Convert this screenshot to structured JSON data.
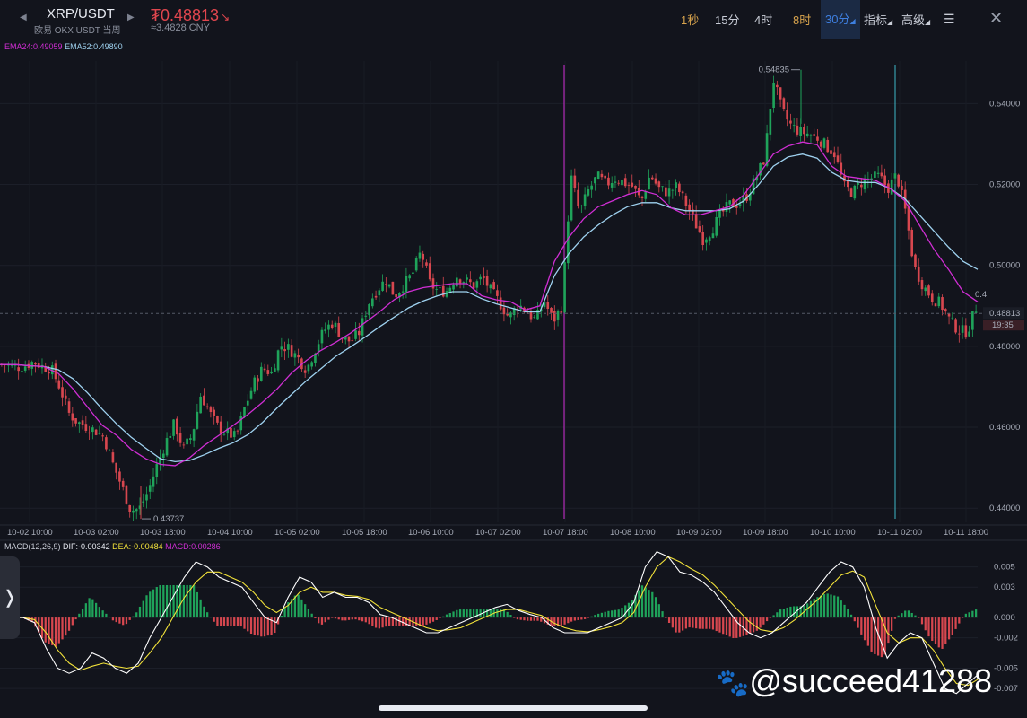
{
  "header": {
    "pair": "XRP/USDT",
    "exchange": "欧易 OKX USDT 当周",
    "price": "₮0.48813",
    "price_arrow": "↘",
    "cny": "≈3.4828 CNY",
    "timeframes": [
      "1秒",
      "15分",
      "4时",
      "8时",
      "30分"
    ],
    "active_timeframe": "30分",
    "indicators": "指标",
    "advanced": "高级",
    "prev_icon": "◀",
    "next_icon": "▶",
    "settings_icon": "settings-icon",
    "close_icon": "close-icon"
  },
  "side_tab": "❭",
  "watermark": "@succeed41288",
  "colors": {
    "up": "#1fa35a",
    "down": "#d7474f",
    "ema24": "#d02ed4",
    "ema52": "#9fd2f0",
    "dif": "#ffffff",
    "dea": "#f2e23a",
    "accent": "#3e7fe0"
  },
  "chart_data": [
    {
      "type": "candlestick",
      "legend": {
        "ema24": "EMA24:0.49059",
        "ema52": "EMA52:0.49890"
      },
      "y_ticks": [
        "0.54000",
        "0.52000",
        "0.50000",
        "0.48000",
        "0.46000",
        "0.44000"
      ],
      "y_tick_values": [
        0.54,
        0.52,
        0.5,
        0.48,
        0.46,
        0.44
      ],
      "ylim": [
        0.4365,
        0.5505
      ],
      "x_ticks": [
        "10-02 10:00",
        "10-03 02:00",
        "10-03 18:00",
        "10-04 10:00",
        "10-05 02:00",
        "10-05 18:00",
        "10-06 10:00",
        "10-07 02:00",
        "10-07 18:00",
        "10-08 10:00",
        "10-09 02:00",
        "10-09 18:00",
        "10-10 10:00",
        "10-11 02:00",
        "10-11 18:00"
      ],
      "high_label": "0.54835",
      "low_label": "0.43737",
      "current_price": "0.48813",
      "current_price_value": 0.48813,
      "countdown": "19:35",
      "last_small_label": "0.4",
      "path": [
        0.4755,
        0.4755,
        0.4748,
        0.4752,
        0.4762,
        0.475,
        0.4745,
        0.4698,
        0.4635,
        0.4612,
        0.4602,
        0.4592,
        0.4575,
        0.451,
        0.4455,
        0.4395,
        0.4398,
        0.4442,
        0.4505,
        0.4562,
        0.461,
        0.4545,
        0.458,
        0.4682,
        0.4635,
        0.4598,
        0.4585,
        0.4575,
        0.465,
        0.4708,
        0.4745,
        0.4735,
        0.4802,
        0.4795,
        0.4772,
        0.4742,
        0.4795,
        0.484,
        0.486,
        0.4822,
        0.4812,
        0.4835,
        0.4905,
        0.494,
        0.4965,
        0.4925,
        0.4952,
        0.4978,
        0.5035,
        0.4955,
        0.4935,
        0.4938,
        0.4975,
        0.4962,
        0.495,
        0.497,
        0.4935,
        0.4905,
        0.487,
        0.4905,
        0.4885,
        0.4865,
        0.4912,
        0.4862,
        0.49,
        0.522,
        0.513,
        0.5185,
        0.522,
        0.52,
        0.5215,
        0.5205,
        0.5195,
        0.5158,
        0.5225,
        0.519,
        0.518,
        0.5195,
        0.5155,
        0.511,
        0.5065,
        0.5088,
        0.5125,
        0.515,
        0.5152,
        0.5172,
        0.5215,
        0.5265,
        0.546,
        0.538,
        0.5345,
        0.533,
        0.5325,
        0.5315,
        0.5295,
        0.5275,
        0.5195,
        0.518,
        0.5205,
        0.5215,
        0.522,
        0.519,
        0.5225,
        0.5132,
        0.4995,
        0.495,
        0.492,
        0.4905,
        0.4865,
        0.484,
        0.4835,
        0.4895
      ],
      "ema24_path": [
        0.4755,
        0.4755,
        0.4752,
        0.475,
        0.4733,
        0.4695,
        0.465,
        0.4605,
        0.458,
        0.4545,
        0.4522,
        0.4508,
        0.4505,
        0.4525,
        0.4555,
        0.458,
        0.4605,
        0.4632,
        0.4662,
        0.4695,
        0.4735,
        0.4765,
        0.479,
        0.481,
        0.4832,
        0.4858,
        0.4885,
        0.4915,
        0.4935,
        0.4945,
        0.495,
        0.4955,
        0.4955,
        0.4925,
        0.4915,
        0.491,
        0.489,
        0.49,
        0.501,
        0.507,
        0.5115,
        0.5145,
        0.516,
        0.5175,
        0.5185,
        0.5175,
        0.5142,
        0.5125,
        0.5125,
        0.5135,
        0.5145,
        0.5175,
        0.5225,
        0.5275,
        0.5295,
        0.5305,
        0.5298,
        0.5245,
        0.522,
        0.5215,
        0.521,
        0.519,
        0.516,
        0.51,
        0.504,
        0.499,
        0.4935,
        0.491
      ],
      "ema52_path": [
        0.4755,
        0.4755,
        0.4752,
        0.475,
        0.4742,
        0.472,
        0.4685,
        0.4645,
        0.4608,
        0.4575,
        0.4548,
        0.4522,
        0.4515,
        0.4518,
        0.4532,
        0.4548,
        0.4562,
        0.4582,
        0.4612,
        0.4648,
        0.4682,
        0.4715,
        0.4745,
        0.4775,
        0.4798,
        0.4822,
        0.4848,
        0.4872,
        0.4895,
        0.4912,
        0.4925,
        0.4935,
        0.4935,
        0.4918,
        0.4905,
        0.4895,
        0.4885,
        0.4885,
        0.4975,
        0.503,
        0.507,
        0.51,
        0.5125,
        0.5145,
        0.5155,
        0.5155,
        0.5142,
        0.5135,
        0.5135,
        0.5135,
        0.514,
        0.516,
        0.52,
        0.5245,
        0.5268,
        0.5275,
        0.5265,
        0.523,
        0.521,
        0.5205,
        0.5205,
        0.519,
        0.5165,
        0.5125,
        0.5085,
        0.5045,
        0.501,
        0.499
      ],
      "markers": [
        0.4768,
        0.5007
      ]
    },
    {
      "type": "macd",
      "legend": {
        "params": "MACD(12,26,9)",
        "dif": "DIF:-0.00342",
        "dea": "DEA:-0.00484",
        "macd": "MACD:0.00286"
      },
      "y_ticks": [
        "0.005",
        "0.003",
        "0.000",
        "-0.002",
        "-0.005",
        "-0.007"
      ],
      "y_tick_values": [
        0.005,
        0.003,
        0.0,
        -0.002,
        -0.005,
        -0.007
      ],
      "ylim": [
        -0.0077,
        0.0063
      ],
      "dif": [
        0.0,
        0.0,
        0.0,
        -0.0005,
        -0.003,
        -0.005,
        -0.0055,
        -0.005,
        -0.0035,
        -0.004,
        -0.005,
        -0.0055,
        -0.0045,
        -0.002,
        0.0,
        0.002,
        0.004,
        0.0055,
        0.005,
        0.004,
        0.0035,
        0.003,
        0.0015,
        0.0,
        -0.0005,
        0.002,
        0.004,
        0.0035,
        0.002,
        0.0025,
        0.002,
        0.002,
        0.0015,
        0.0003,
        0.0,
        -0.0005,
        -0.001,
        -0.0015,
        -0.0015,
        -0.001,
        -0.0005,
        0.0,
        0.0005,
        0.001,
        0.0013,
        0.0007,
        0.0003,
        0.0,
        -0.001,
        -0.0015,
        -0.0015,
        -0.0015,
        -0.001,
        -0.0005,
        0.0,
        0.0015,
        0.005,
        0.0065,
        0.006,
        0.0045,
        0.0042,
        0.0035,
        0.0025,
        0.001,
        -0.0005,
        -0.0015,
        -0.002,
        -0.0015,
        -0.0005,
        0.0005,
        0.0015,
        0.003,
        0.0045,
        0.0055,
        0.005,
        0.003,
        -0.001,
        -0.004,
        -0.0025,
        -0.0015,
        -0.002,
        -0.0045,
        -0.007,
        -0.0075,
        -0.0065,
        -0.0055
      ],
      "dea": [
        0.0,
        0.0,
        0.0,
        -0.0002,
        -0.0015,
        -0.0032,
        -0.0045,
        -0.0052,
        -0.0048,
        -0.0045,
        -0.0048,
        -0.005,
        -0.0048,
        -0.0035,
        -0.002,
        0.0,
        0.002,
        0.0035,
        0.0045,
        0.0045,
        0.004,
        0.0035,
        0.0025,
        0.0012,
        0.0005,
        0.0012,
        0.0025,
        0.003,
        0.0025,
        0.0025,
        0.0022,
        0.0021,
        0.0018,
        0.001,
        0.0005,
        0.0,
        -0.0005,
        -0.001,
        -0.0013,
        -0.0012,
        -0.001,
        -0.0005,
        0.0,
        0.0005,
        0.0008,
        0.0008,
        0.0005,
        0.0002,
        -0.0005,
        -0.001,
        -0.0013,
        -0.0014,
        -0.0012,
        -0.0009,
        -0.0005,
        0.0005,
        0.003,
        0.005,
        0.006,
        0.0055,
        0.0048,
        0.0042,
        0.0032,
        0.002,
        0.0008,
        -0.0004,
        -0.0012,
        -0.0014,
        -0.001,
        -0.0002,
        0.0008,
        0.0018,
        0.003,
        0.0042,
        0.0046,
        0.004,
        0.0012,
        -0.0015,
        -0.0025,
        -0.002,
        -0.002,
        -0.0032,
        -0.005,
        -0.0065,
        -0.0067,
        -0.006
      ]
    }
  ]
}
